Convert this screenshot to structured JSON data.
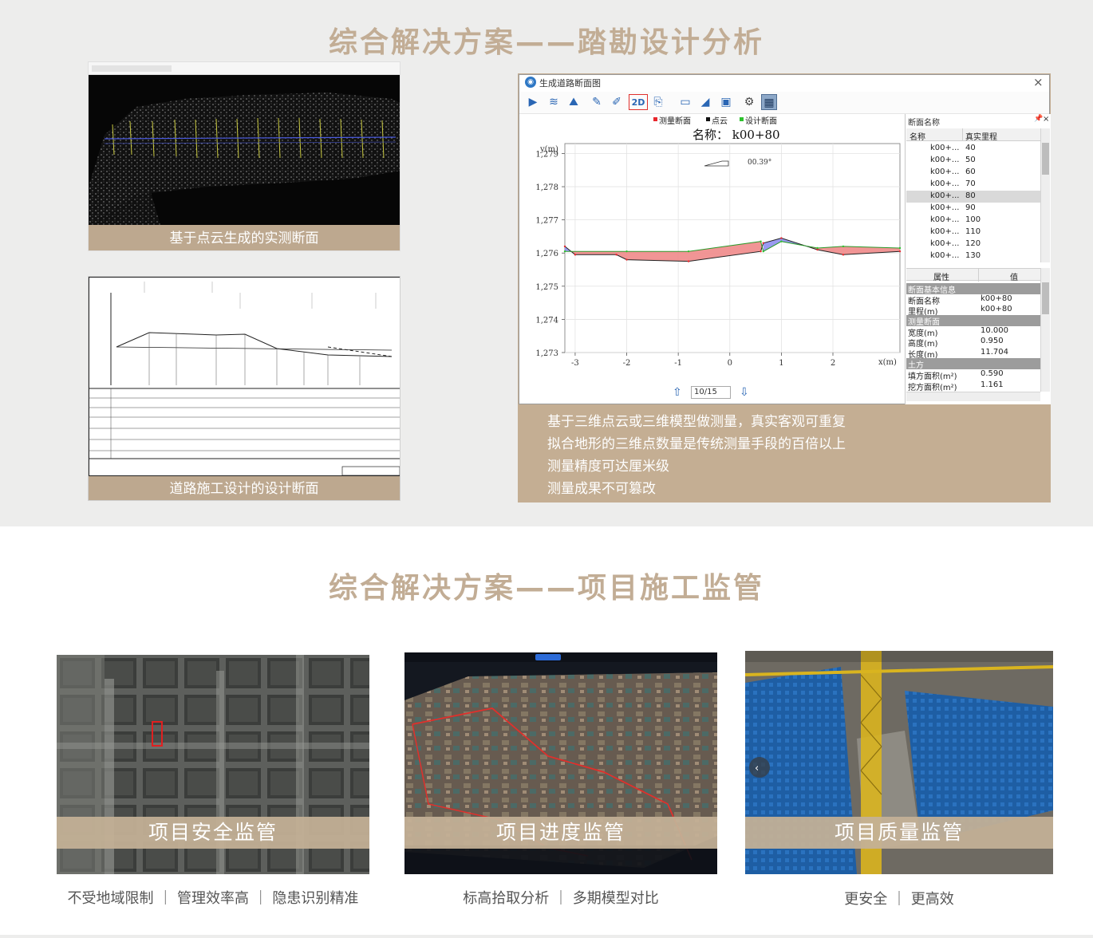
{
  "section1": {
    "title": "综合解决方案——踏勘设计分析",
    "panel1_caption": "基于点云生成的实测断面",
    "panel2_caption": "道路施工设计的设计断面",
    "app": {
      "window_title": "生成道路断面图",
      "close_symbol": "×",
      "legend": [
        "测量断面",
        "点云",
        "设计断面"
      ],
      "legend_colors": [
        "#e8262c",
        "#111111",
        "#2dc22d"
      ],
      "chart_title": "名称：  k00+80",
      "y_axis_label": "y(m)",
      "x_axis_label": "x(m)",
      "slope_label": "00.39°",
      "page_indicator": "10/15",
      "list_header": "断面名称",
      "list_columns": [
        "名称",
        "真实里程"
      ],
      "list_rows": [
        {
          "name": "k00+...",
          "mileage": "40"
        },
        {
          "name": "k00+...",
          "mileage": "50"
        },
        {
          "name": "k00+...",
          "mileage": "60"
        },
        {
          "name": "k00+...",
          "mileage": "70"
        },
        {
          "name": "k00+...",
          "mileage": "80"
        },
        {
          "name": "k00+...",
          "mileage": "90"
        },
        {
          "name": "k00+...",
          "mileage": "100"
        },
        {
          "name": "k00+...",
          "mileage": "110"
        },
        {
          "name": "k00+...",
          "mileage": "120"
        },
        {
          "name": "k00+...",
          "mileage": "130"
        }
      ],
      "prop_columns": [
        "属性",
        "值"
      ],
      "props": [
        {
          "type": "group",
          "label": "断面基本信息"
        },
        {
          "type": "row",
          "label": "断面名称",
          "value": "k00+80"
        },
        {
          "type": "row",
          "label": "里程(m)",
          "value": "k00+80"
        },
        {
          "type": "group",
          "label": "测量断面"
        },
        {
          "type": "row",
          "label": "宽度(m)",
          "value": "10.000"
        },
        {
          "type": "row",
          "label": "高度(m)",
          "value": "0.950"
        },
        {
          "type": "row",
          "label": "长度(m)",
          "value": "11.704"
        },
        {
          "type": "group",
          "label": "土方"
        },
        {
          "type": "row",
          "label": "填方面积(m²)",
          "value": "0.590"
        },
        {
          "type": "row",
          "label": "挖方面积(m²)",
          "value": "1.161"
        }
      ]
    },
    "app_caption_lines": [
      "基于三维点云或三维模型做测量，真实客观可重复",
      "拟合地形的三维点数量是传统测量手段的百倍以上",
      "测量精度可达厘米级",
      "测量成果不可篡改"
    ]
  },
  "section2": {
    "title": "综合解决方案——项目施工监管",
    "cards": [
      {
        "label": "项目安全监管",
        "sub": "不受地域限制 ｜ 管理效率高 ｜ 隐患识别精准"
      },
      {
        "label": "项目进度监管",
        "sub": "标高拾取分析 ｜ 多期模型对比"
      },
      {
        "label": "项目质量监管",
        "sub": "更安全 ｜ 更高效"
      }
    ]
  },
  "chart_data": {
    "type": "line",
    "x_ticks": [
      "-3",
      "-2",
      "-1",
      "0",
      "1",
      "2"
    ],
    "y_ticks": [
      "1,279",
      "1,278",
      "1,277",
      "1,276",
      "1,275",
      "1,274",
      "1,273"
    ],
    "xlim": [
      -3.2,
      3.3
    ],
    "ylim": [
      1273,
      1279.3
    ],
    "series": [
      {
        "name": "测量断面",
        "x": [
          -3.2,
          -3.0,
          -2.2,
          -2.0,
          -0.8,
          0.6,
          0.65,
          1.0,
          1.7,
          2.2,
          3.3
        ],
        "y": [
          1276.2,
          1275.95,
          1275.95,
          1275.8,
          1275.75,
          1276.05,
          1276.3,
          1276.45,
          1276.1,
          1275.95,
          1276.05
        ]
      },
      {
        "name": "设计断面",
        "x": [
          -3.2,
          -2.0,
          -0.8,
          0.6,
          0.65,
          1.0,
          1.7,
          2.2,
          3.3
        ],
        "y": [
          1276.05,
          1276.05,
          1276.05,
          1276.35,
          1276.05,
          1276.35,
          1276.15,
          1276.2,
          1276.15
        ]
      }
    ]
  }
}
